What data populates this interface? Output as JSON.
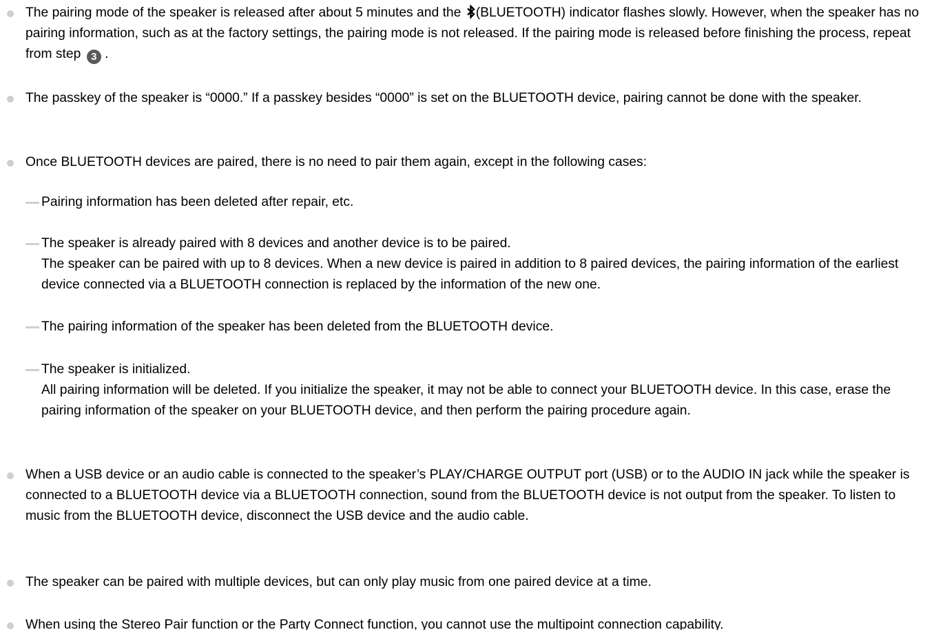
{
  "notes": [
    {
      "parts": {
        "a": "The pairing mode of the speaker is released after about 5 minutes and the ",
        "b": "(BLUETOOTH) indicator flashes slowly. However, when the speaker has no pairing information, such as at the factory settings, the pairing mode is not released. If the pairing mode is released before finishing the process, repeat from step ",
        "step": "3",
        "c": " ."
      },
      "icon": "bluetooth-icon"
    },
    {
      "text": "The passkey of the speaker is “0000.” If a passkey besides “0000” is set on the BLUETOOTH device, pairing cannot be done with the speaker."
    },
    {
      "text": "Once BLUETOOTH devices are paired, there is no need to pair them again, except in the following cases:",
      "sub_items": [
        {
          "line1": "Pairing information has been deleted after repair, etc."
        },
        {
          "line1": "The speaker is already paired with 8 devices and another device is to be paired.",
          "line2": "The speaker can be paired with up to 8 devices. When a new device is paired in addition to 8 paired devices, the pairing information of the earliest device connected via a BLUETOOTH connection is replaced by the information of the new one."
        },
        {
          "line1": "The pairing information of the speaker has been deleted from the BLUETOOTH device."
        },
        {
          "line1": "The speaker is initialized.",
          "line2": "All pairing information will be deleted. If you initialize the speaker, it may not be able to connect your BLUETOOTH device. In this case, erase the pairing information of the speaker on your BLUETOOTH device, and then perform the pairing procedure again."
        }
      ]
    },
    {
      "text": "When a USB device or an audio cable is connected to the speaker’s PLAY/CHARGE OUTPUT port (USB) or to the AUDIO IN jack while the speaker is connected to a BLUETOOTH device via a BLUETOOTH connection, sound from the BLUETOOTH device is not output from the speaker. To listen to music from the BLUETOOTH device, disconnect the USB device and the audio cable."
    },
    {
      "text": "The speaker can be paired with multiple devices, but can only play music from one paired device at a time."
    },
    {
      "text": "When using the Stereo Pair function or the Party Connect function, you cannot use the multipoint connection capability."
    }
  ],
  "colors": {
    "bullet": "#cfcfcf",
    "step_badge": "#5a5a5a",
    "text": "#000000"
  }
}
